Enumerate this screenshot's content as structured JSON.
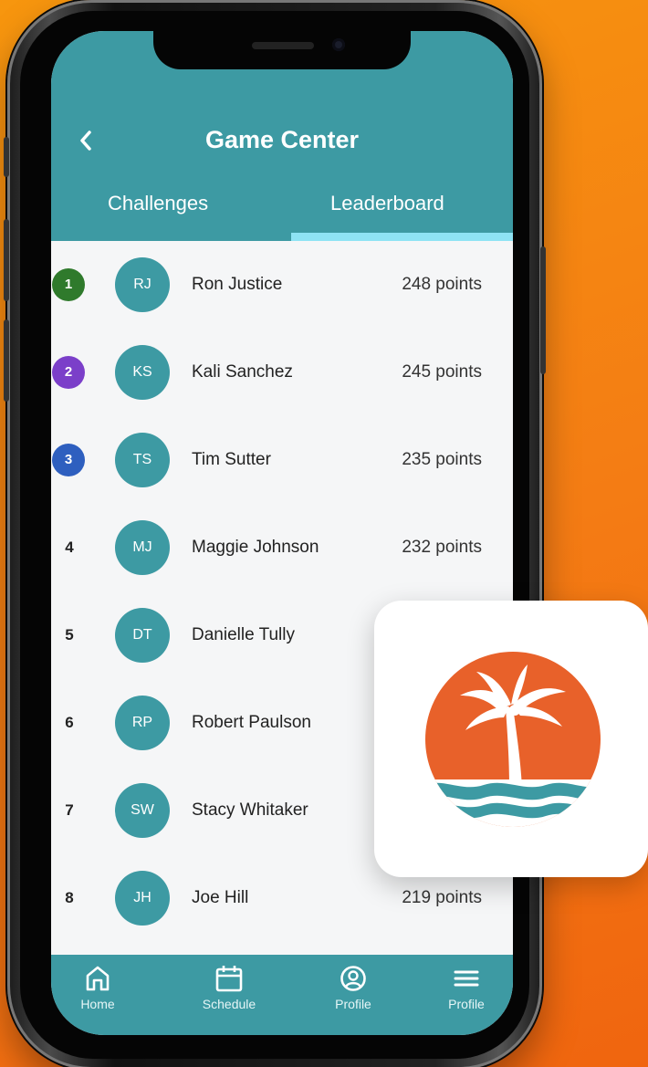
{
  "header": {
    "title": "Game Center",
    "back_icon": "chevron-left-icon"
  },
  "tabs": [
    {
      "label": "Challenges",
      "active": false
    },
    {
      "label": "Leaderboard",
      "active": true
    }
  ],
  "leaderboard": [
    {
      "rank": "1",
      "initials": "RJ",
      "name": "Ron Justice",
      "points": "248 points",
      "badge": "gold"
    },
    {
      "rank": "2",
      "initials": "KS",
      "name": "Kali Sanchez",
      "points": "245 points",
      "badge": "purple"
    },
    {
      "rank": "3",
      "initials": "TS",
      "name": "Tim Sutter",
      "points": "235 points",
      "badge": "blue"
    },
    {
      "rank": "4",
      "initials": "MJ",
      "name": "Maggie Johnson",
      "points": "232 points"
    },
    {
      "rank": "5",
      "initials": "DT",
      "name": "Danielle Tully",
      "points": ""
    },
    {
      "rank": "6",
      "initials": "RP",
      "name": "Robert Paulson",
      "points": ""
    },
    {
      "rank": "7",
      "initials": "SW",
      "name": "Stacy Whitaker",
      "points": ""
    },
    {
      "rank": "8",
      "initials": "JH",
      "name": "Joe Hill",
      "points": "219 points"
    }
  ],
  "bottom_nav": [
    {
      "label": "Home",
      "icon": "home-icon"
    },
    {
      "label": "Schedule",
      "icon": "calendar-icon"
    },
    {
      "label": "Profile",
      "icon": "user-circle-icon"
    },
    {
      "label": "Profile",
      "icon": "menu-icon"
    }
  ],
  "colors": {
    "primary": "#3d9aa3",
    "tab_indicator": "#8ee3f4",
    "background_orange": "#f47c14",
    "logo_orange": "#e8612a"
  }
}
